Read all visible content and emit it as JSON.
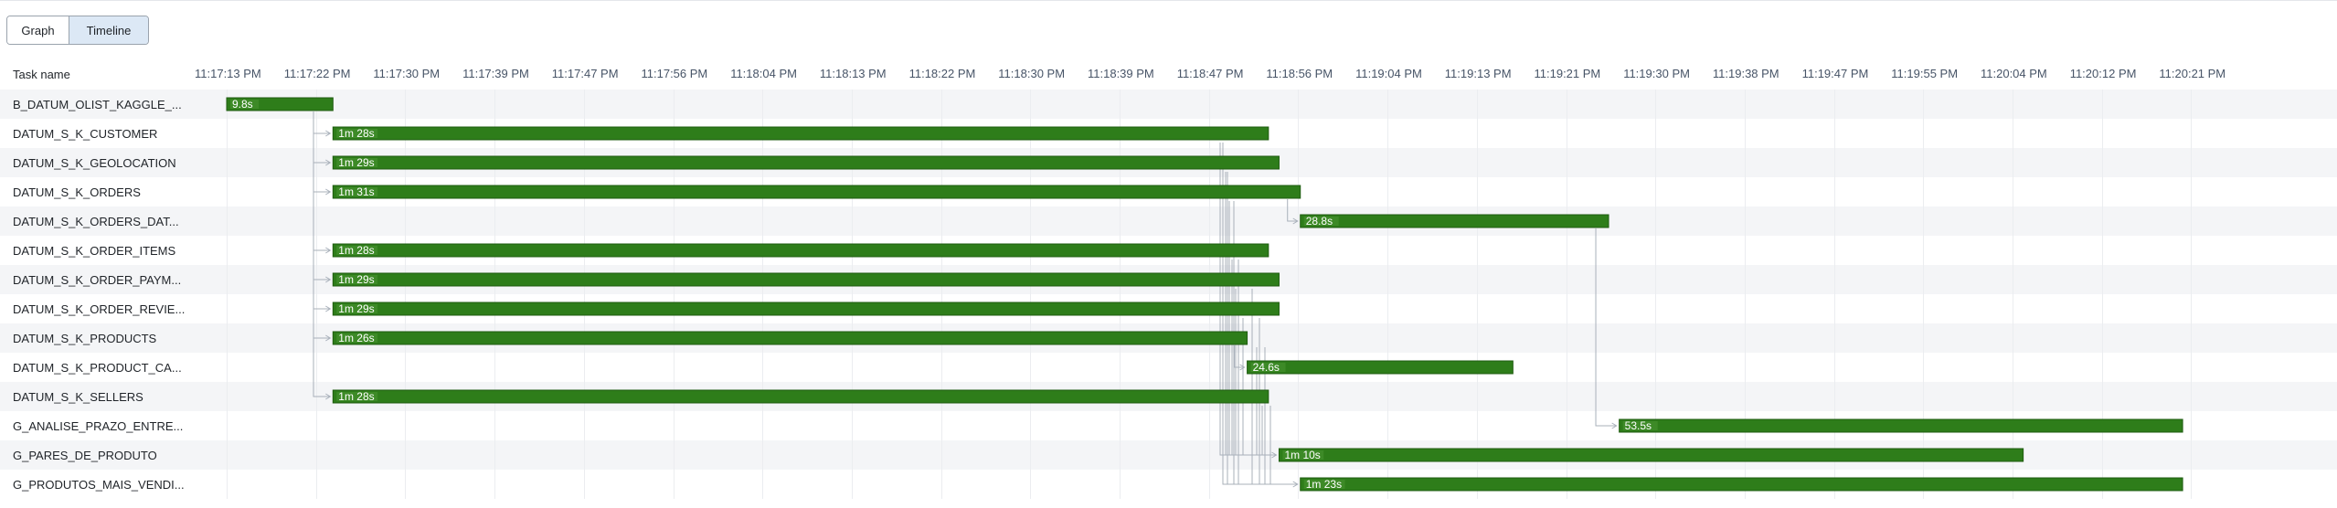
{
  "toggle": {
    "graph_label": "Graph",
    "timeline_label": "Timeline"
  },
  "timeline": {
    "task_header": "Task name",
    "ticks": [
      "11:17:13 PM",
      "11:17:22 PM",
      "11:17:30 PM",
      "11:17:39 PM",
      "11:17:47 PM",
      "11:17:56 PM",
      "11:18:04 PM",
      "11:18:13 PM",
      "11:18:22 PM",
      "11:18:30 PM",
      "11:18:39 PM",
      "11:18:47 PM",
      "11:18:56 PM",
      "11:19:04 PM",
      "11:19:13 PM",
      "11:19:21 PM",
      "11:19:30 PM",
      "11:19:38 PM",
      "11:19:47 PM",
      "11:19:55 PM",
      "11:20:04 PM",
      "11:20:12 PM",
      "11:20:21 PM"
    ],
    "tasks": [
      {
        "name": "B_DATUM_OLIST_KAGGLE_...",
        "start": "11:17:13",
        "end": "11:17:23",
        "duration": "9.8s",
        "depends_on": null
      },
      {
        "name": "DATUM_S_K_CUSTOMER",
        "start": "11:17:23",
        "end": "11:18:51",
        "duration": "1m 28s",
        "depends_on": 0
      },
      {
        "name": "DATUM_S_K_GEOLOCATION",
        "start": "11:17:23",
        "end": "11:18:52",
        "duration": "1m 29s",
        "depends_on": 0
      },
      {
        "name": "DATUM_S_K_ORDERS",
        "start": "11:17:23",
        "end": "11:18:54",
        "duration": "1m 31s",
        "depends_on": 0
      },
      {
        "name": "DATUM_S_K_ORDERS_DAT...",
        "start": "11:18:54",
        "end": "11:19:23",
        "duration": "28.8s",
        "depends_on": 3
      },
      {
        "name": "DATUM_S_K_ORDER_ITEMS",
        "start": "11:17:23",
        "end": "11:18:51",
        "duration": "1m 28s",
        "depends_on": 0
      },
      {
        "name": "DATUM_S_K_ORDER_PAYM...",
        "start": "11:17:23",
        "end": "11:18:52",
        "duration": "1m 29s",
        "depends_on": 0
      },
      {
        "name": "DATUM_S_K_ORDER_REVIE...",
        "start": "11:17:23",
        "end": "11:18:52",
        "duration": "1m 29s",
        "depends_on": 0
      },
      {
        "name": "DATUM_S_K_PRODUCTS",
        "start": "11:17:23",
        "end": "11:18:49",
        "duration": "1m 26s",
        "depends_on": 0
      },
      {
        "name": "DATUM_S_K_PRODUCT_CA...",
        "start": "11:18:49",
        "end": "11:19:14",
        "duration": "24.6s",
        "depends_on": 8
      },
      {
        "name": "DATUM_S_K_SELLERS",
        "start": "11:17:23",
        "end": "11:18:51",
        "duration": "1m 28s",
        "depends_on": 0
      },
      {
        "name": "G_ANALISE_PRAZO_ENTRE...",
        "start": "11:19:24",
        "end": "11:20:17",
        "duration": "53.5s",
        "depends_on": 4
      },
      {
        "name": "G_PARES_DE_PRODUTO",
        "start": "11:18:52",
        "end": "11:20:02",
        "duration": "1m 10s",
        "depends_on": [
          1,
          2,
          3,
          5,
          6,
          7,
          8,
          10
        ]
      },
      {
        "name": "G_PRODUTOS_MAIS_VENDI...",
        "start": "11:18:54",
        "end": "11:20:17",
        "duration": "1m 23s",
        "depends_on": [
          1,
          2,
          3,
          5,
          6,
          7,
          8,
          10
        ]
      }
    ],
    "colors": {
      "bar": "#2e7d1a",
      "bar_border": "#1f5c10",
      "label_bg": "#3d8a27",
      "connector": "#a8b0ba",
      "row_alt": "#f4f5f7",
      "toggle_active": "#dce8f5"
    }
  }
}
